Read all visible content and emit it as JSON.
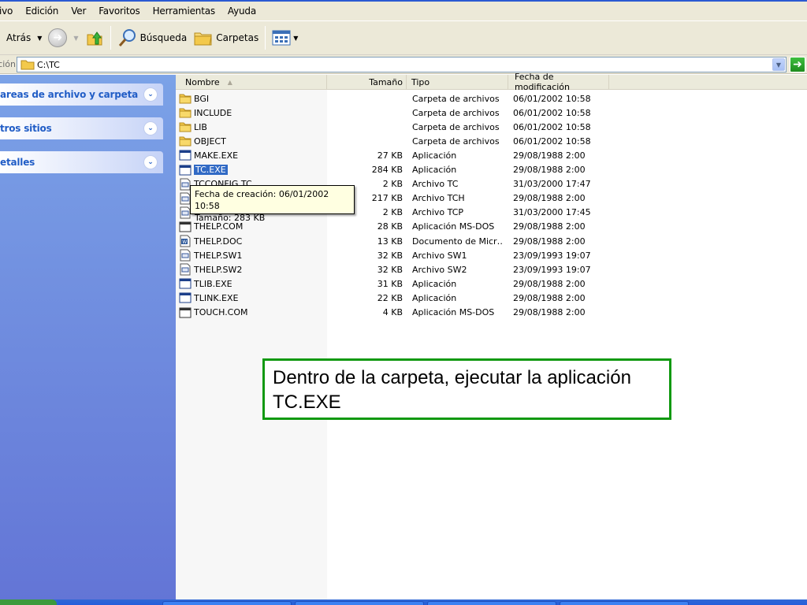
{
  "menu": [
    "ivo",
    "Edición",
    "Ver",
    "Favoritos",
    "Herramientas",
    "Ayuda"
  ],
  "toolbar": {
    "back_label": "Atrás",
    "search_label": "Búsqueda",
    "folders_label": "Carpetas"
  },
  "address": {
    "label": "ción",
    "value": "C:\\TC"
  },
  "taskpane": {
    "panels": [
      "areas de archivo y carpeta",
      "tros sitios",
      "etalles"
    ]
  },
  "columns": {
    "name": "Nombre",
    "size": "Tamaño",
    "type": "Tipo",
    "date": "Fecha de modificación"
  },
  "files": [
    {
      "name": "BGI",
      "size": "",
      "type": "Carpeta de archivos",
      "date": "06/01/2002 10:58",
      "icon": "folder-icon"
    },
    {
      "name": "INCLUDE",
      "size": "",
      "type": "Carpeta de archivos",
      "date": "06/01/2002 10:58",
      "icon": "folder-icon"
    },
    {
      "name": "LIB",
      "size": "",
      "type": "Carpeta de archivos",
      "date": "06/01/2002 10:58",
      "icon": "folder-icon"
    },
    {
      "name": "OBJECT",
      "size": "",
      "type": "Carpeta de archivos",
      "date": "06/01/2002 10:58",
      "icon": "folder-icon"
    },
    {
      "name": "MAKE.EXE",
      "size": "27 KB",
      "type": "Aplicación",
      "date": "29/08/1988 2:00",
      "icon": "app-icon"
    },
    {
      "name": "TC.EXE",
      "size": "284 KB",
      "type": "Aplicación",
      "date": "29/08/1988 2:00",
      "icon": "app-icon",
      "selected": true
    },
    {
      "name": "TCCONFIG.TC",
      "size": "2 KB",
      "type": "Archivo TC",
      "date": "31/03/2000 17:47",
      "icon": "file-icon"
    },
    {
      "name": "",
      "size": "217 KB",
      "type": "Archivo TCH",
      "date": "29/08/1988 2:00",
      "icon": "file-icon"
    },
    {
      "name": "",
      "size": "2 KB",
      "type": "Archivo TCP",
      "date": "31/03/2000 17:45",
      "icon": "file-icon"
    },
    {
      "name": "THELP.COM",
      "size": "28 KB",
      "type": "Aplicación MS-DOS",
      "date": "29/08/1988 2:00",
      "icon": "dos-app-icon"
    },
    {
      "name": "THELP.DOC",
      "size": "13 KB",
      "type": "Documento de Micr…",
      "date": "29/08/1988 2:00",
      "icon": "word-doc-icon"
    },
    {
      "name": "THELP.SW1",
      "size": "32 KB",
      "type": "Archivo SW1",
      "date": "23/09/1993 19:07",
      "icon": "file-icon"
    },
    {
      "name": "THELP.SW2",
      "size": "32 KB",
      "type": "Archivo SW2",
      "date": "23/09/1993 19:07",
      "icon": "file-icon"
    },
    {
      "name": "TLIB.EXE",
      "size": "31 KB",
      "type": "Aplicación",
      "date": "29/08/1988 2:00",
      "icon": "app-icon"
    },
    {
      "name": "TLINK.EXE",
      "size": "22 KB",
      "type": "Aplicación",
      "date": "29/08/1988 2:00",
      "icon": "app-icon"
    },
    {
      "name": "TOUCH.COM",
      "size": "4 KB",
      "type": "Aplicación MS-DOS",
      "date": "29/08/1988 2:00",
      "icon": "dos-app-icon"
    }
  ],
  "tooltip": {
    "line1": "Fecha de creación: 06/01/2002 10:58",
    "line2": "Tamaño: 283 KB"
  },
  "annotation": {
    "line1": "Dentro de la carpeta, ejecutar la aplicación",
    "line2": "TC.EXE"
  }
}
